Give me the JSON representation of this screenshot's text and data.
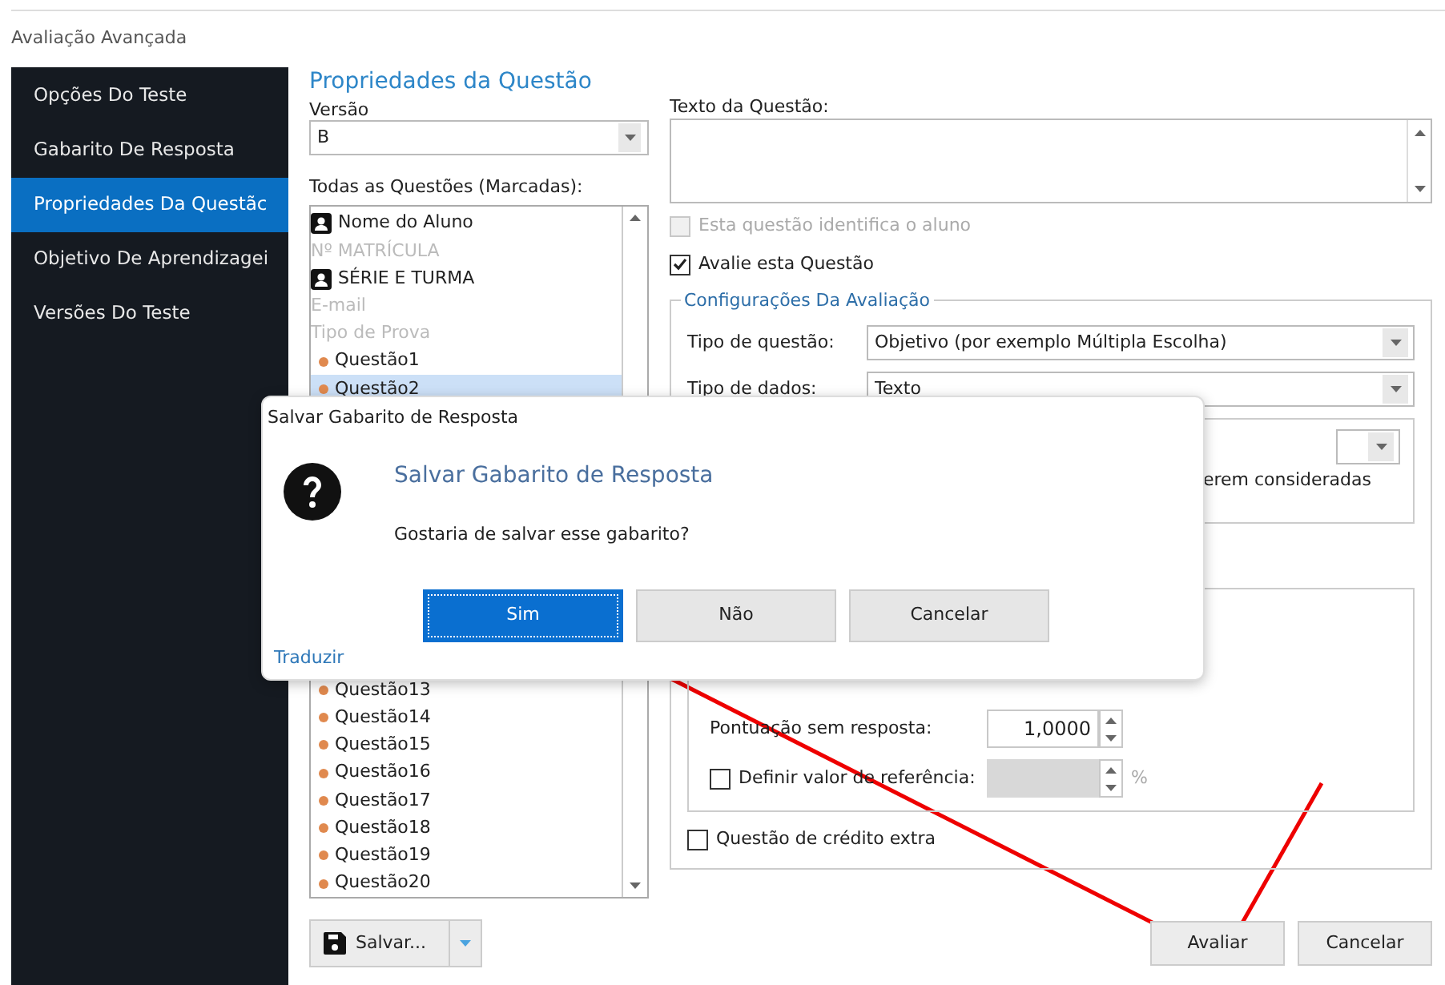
{
  "window": {
    "title": "Avaliação Avançada"
  },
  "sidebar": {
    "items": [
      {
        "label": "Opções Do Teste",
        "selected": false
      },
      {
        "label": "Gabarito De Resposta",
        "selected": false
      },
      {
        "label": "Propriedades Da Questãc",
        "selected": true
      },
      {
        "label": "Objetivo De Aprendizagei",
        "selected": false
      },
      {
        "label": "Versões Do Teste",
        "selected": false
      }
    ]
  },
  "panel": {
    "title": "Propriedades da Questão",
    "version": {
      "label": "Versão",
      "value": "B"
    },
    "questions_label": "Todas as Questões (Marcadas):",
    "questions": [
      {
        "label": "Nome do Aluno",
        "kind": "student",
        "selected": false
      },
      {
        "label": "Nº MATRÍCULA",
        "kind": "unused",
        "selected": false
      },
      {
        "label": "SÉRIE E TURMA",
        "kind": "student",
        "selected": false
      },
      {
        "label": "E-mail",
        "kind": "unused",
        "selected": false
      },
      {
        "label": "Tipo de Prova",
        "kind": "unused",
        "selected": false
      },
      {
        "label": "Questão1",
        "kind": "question",
        "selected": false
      },
      {
        "label": "Questão2",
        "kind": "question",
        "selected": true
      },
      {
        "label": "Questão13",
        "kind": "question",
        "selected": false
      },
      {
        "label": "Questão14",
        "kind": "question",
        "selected": false
      },
      {
        "label": "Questão15",
        "kind": "question",
        "selected": false
      },
      {
        "label": "Questão16",
        "kind": "question",
        "selected": false
      },
      {
        "label": "Questão17",
        "kind": "question",
        "selected": false
      },
      {
        "label": "Questão18",
        "kind": "question",
        "selected": false
      },
      {
        "label": "Questão19",
        "kind": "question",
        "selected": false
      },
      {
        "label": "Questão20",
        "kind": "question",
        "selected": false
      }
    ],
    "question_text": {
      "label": "Texto da Questão:"
    },
    "checks": [
      {
        "label": "Esta questão identifica o aluno",
        "checked": false,
        "disabled": true
      },
      {
        "label": "Avalie esta Questão",
        "checked": true,
        "disabled": false
      }
    ],
    "settings": {
      "title": "Configurações Da Avaliação",
      "selects": [
        {
          "label": "Tipo de questão:",
          "value": "Objetivo (por exemplo Múltipla Escolha)"
        },
        {
          "label": "Tipo de dados:",
          "value": "Texto"
        }
      ],
      "partial_note": "erem consideradas",
      "scores": [
        {
          "kind": "spin",
          "label": "Pontuação sem resposta:",
          "value": "1,0000"
        },
        {
          "kind": "check-spin",
          "label": "Definir valor de referência:",
          "checked": false,
          "unit": "%"
        }
      ],
      "extra": {
        "label": "Questão de crédito extra",
        "checked": false
      }
    },
    "save_button": "Salvar...",
    "buttons": [
      "Avaliar",
      "Cancelar"
    ]
  },
  "dialog": {
    "title": "Salvar Gabarito de Resposta",
    "heading": "Salvar Gabarito de Resposta",
    "message": "Gostaria de salvar esse gabarito?",
    "buttons": [
      {
        "label": "Sim",
        "focused": true
      },
      {
        "label": "Não",
        "focused": false
      },
      {
        "label": "Cancelar",
        "focused": false
      }
    ],
    "link": "Traduzir"
  }
}
